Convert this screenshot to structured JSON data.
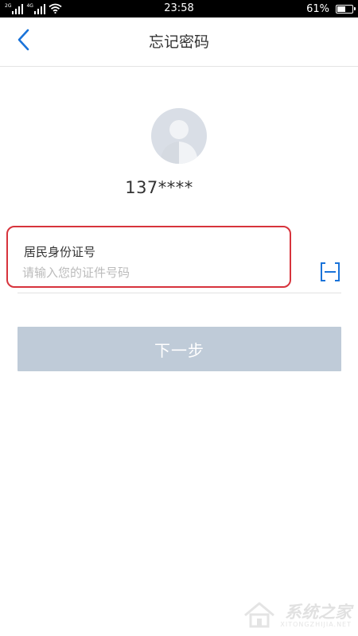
{
  "status_bar": {
    "net_label_1": "2G",
    "net_label_2": "4G",
    "time": "23:58",
    "battery_text": "61%",
    "battery_level_percent": 61
  },
  "header": {
    "title": "忘记密码"
  },
  "account": {
    "number": "137****"
  },
  "id_field": {
    "label": "居民身份证号",
    "placeholder": "请输入您的证件号码",
    "value": ""
  },
  "next_button": {
    "label": "下一步"
  },
  "watermark": {
    "title": "系统之家",
    "url": "XITONGZHIJIA.NET"
  },
  "colors": {
    "accent": "#1a73d9",
    "highlight_border": "#d7333c",
    "button_disabled": "#bfcbd8",
    "avatar_bg": "#d9dee6"
  },
  "icons": {
    "back": "chevron-left-icon",
    "scan": "scan-icon",
    "avatar": "default-user-avatar"
  }
}
